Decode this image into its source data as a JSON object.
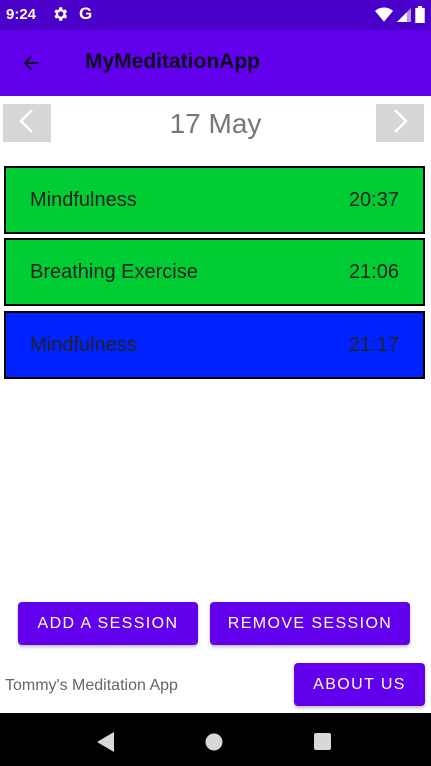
{
  "status_bar": {
    "time": "9:24",
    "icons": [
      "settings-icon",
      "google-icon",
      "wifi-icon",
      "signal-icon",
      "battery-icon"
    ],
    "google_letter": "G"
  },
  "app_bar": {
    "title": "MyMeditationApp",
    "back_icon": "arrow-back-icon"
  },
  "date_nav": {
    "date": "17 May",
    "prev_icon": "chevron-left-icon",
    "next_icon": "chevron-right-icon"
  },
  "sessions": [
    {
      "name": "Mindfulness",
      "time": "20:37",
      "color": "#00cc33"
    },
    {
      "name": "Breathing Exercise",
      "time": "21:06",
      "color": "#00cc33"
    },
    {
      "name": "Mindfulness",
      "time": "21:17",
      "color": "#0022ff"
    }
  ],
  "actions": {
    "add_label": "ADD A SESSION",
    "remove_label": "REMOVE SESSION",
    "about_label": "ABOUT US"
  },
  "footer": {
    "text": "Tommy's Meditation App"
  },
  "colors": {
    "primary": "#6200ee",
    "status_bar": "#4a00c8"
  }
}
